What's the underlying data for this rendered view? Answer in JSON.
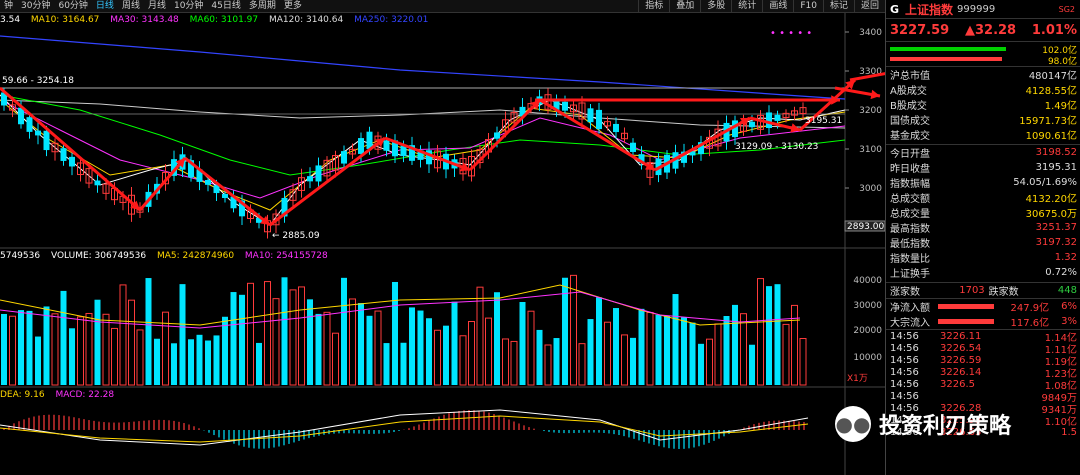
{
  "toolbar": {
    "left_items": [
      "钟",
      "30分钟",
      "60分钟",
      "日线",
      "周线",
      "月线",
      "10分钟",
      "45日线",
      "多周期",
      "更多"
    ],
    "active_index": 3,
    "right_items": [
      "指标",
      "叠加",
      "多股",
      "统计",
      "画线",
      "F10",
      "标记",
      "返回"
    ]
  },
  "ma_line": {
    "ma5": "3.54",
    "ma10": "MA10: 3164.67",
    "ma30": "MA30: 3143.48",
    "ma60": "MA60: 3101.97",
    "ma120": "MA120: 3140.64",
    "ma250": "MA250: 3220.01"
  },
  "volume_line": {
    "ma_tail": "5749536",
    "volume": "VOLUME: 306749536",
    "ma5": "MA5: 242874960",
    "ma10": "MA10: 254155728"
  },
  "macd_line": {
    "dea": "DEA: 9.16",
    "macd": "MACD: 22.28"
  },
  "price_axis": [
    "3400",
    "3300",
    "3200",
    "3100",
    "3000",
    "2900"
  ],
  "volume_axis": [
    "40000",
    "30000",
    "20000",
    "10000"
  ],
  "volume_unit": "X1万",
  "annotations": {
    "hi_left": "59.66 - 3254.18",
    "low": "← 2885.09",
    "range": "3129.09 - 3130.23",
    "last": "3195.31",
    "marker_2893": "2893.00"
  },
  "colors": {
    "up": "#ff3b3b",
    "down": "#00e5ff",
    "ma5": "#ffffff",
    "ma10": "#ffd700",
    "ma30": "#ff33ff",
    "ma60": "#00ff00",
    "ma120": "#cccccc",
    "ma250": "#3344ff",
    "arrow": "#ff1a1a"
  },
  "panel": {
    "code_letter": "G",
    "name": "上证指数",
    "code": "999999",
    "sg": "SG2",
    "price": "3227.59",
    "change": "▲32.28",
    "pct": "1.01%",
    "bar_top": "102.0亿",
    "bar_bottom": "98.0亿",
    "rows_a": [
      {
        "k": "沪总市值",
        "v": "480147亿",
        "c": "w"
      },
      {
        "k": "A股成交",
        "v": "4128.55亿",
        "c": "y"
      },
      {
        "k": "B股成交",
        "v": "1.49亿",
        "c": "y"
      },
      {
        "k": "国债成交",
        "v": "15971.73亿",
        "c": "y"
      },
      {
        "k": "基金成交",
        "v": "1090.61亿",
        "c": "y"
      }
    ],
    "rows_b": [
      {
        "k": "今日开盘",
        "v": "3198.52",
        "c": "r"
      },
      {
        "k": "昨日收盘",
        "v": "3195.31",
        "c": "w"
      },
      {
        "k": "指数振幅",
        "v": "54.05/1.69%",
        "c": "w"
      },
      {
        "k": "总成交额",
        "v": "4132.20亿",
        "c": "y"
      },
      {
        "k": "总成交量",
        "v": "30675.0万",
        "c": "y"
      },
      {
        "k": "最高指数",
        "v": "3251.37",
        "c": "r"
      },
      {
        "k": "最低指数",
        "v": "3197.32",
        "c": "r"
      },
      {
        "k": "指数量比",
        "v": "1.32",
        "c": "r"
      },
      {
        "k": "上证换手",
        "v": "0.72%",
        "c": "w"
      }
    ],
    "updown": {
      "up_label": "涨家数",
      "up": "1703",
      "down_label": "跌家数",
      "down": "448"
    },
    "flows": [
      {
        "k": "净流入额",
        "v": "247.9亿",
        "p": "6%"
      },
      {
        "k": "大宗流入",
        "v": "117.6亿",
        "p": "3%"
      }
    ],
    "ticks": [
      {
        "t": "14:56",
        "p": "3226.11",
        "q": "1.14亿"
      },
      {
        "t": "14:56",
        "p": "3226.54",
        "q": "1.11亿"
      },
      {
        "t": "14:56",
        "p": "3226.59",
        "q": "1.19亿"
      },
      {
        "t": "14:56",
        "p": "3226.14",
        "q": "1.23亿"
      },
      {
        "t": "14:56",
        "p": "3226.5",
        "q": "1.08亿"
      },
      {
        "t": "14:56",
        "p": "",
        "q": "9849万"
      },
      {
        "t": "14:56",
        "p": "3226.28",
        "q": "9341万"
      },
      {
        "t": "14:56",
        "p": "3225.93",
        "q": "1.10亿"
      },
      {
        "t": "14:56",
        "p": "3226.63",
        "q": "1.5"
      }
    ]
  },
  "watermark": {
    "text": "投资利刃策略",
    "icon": "wechat-icon"
  }
}
